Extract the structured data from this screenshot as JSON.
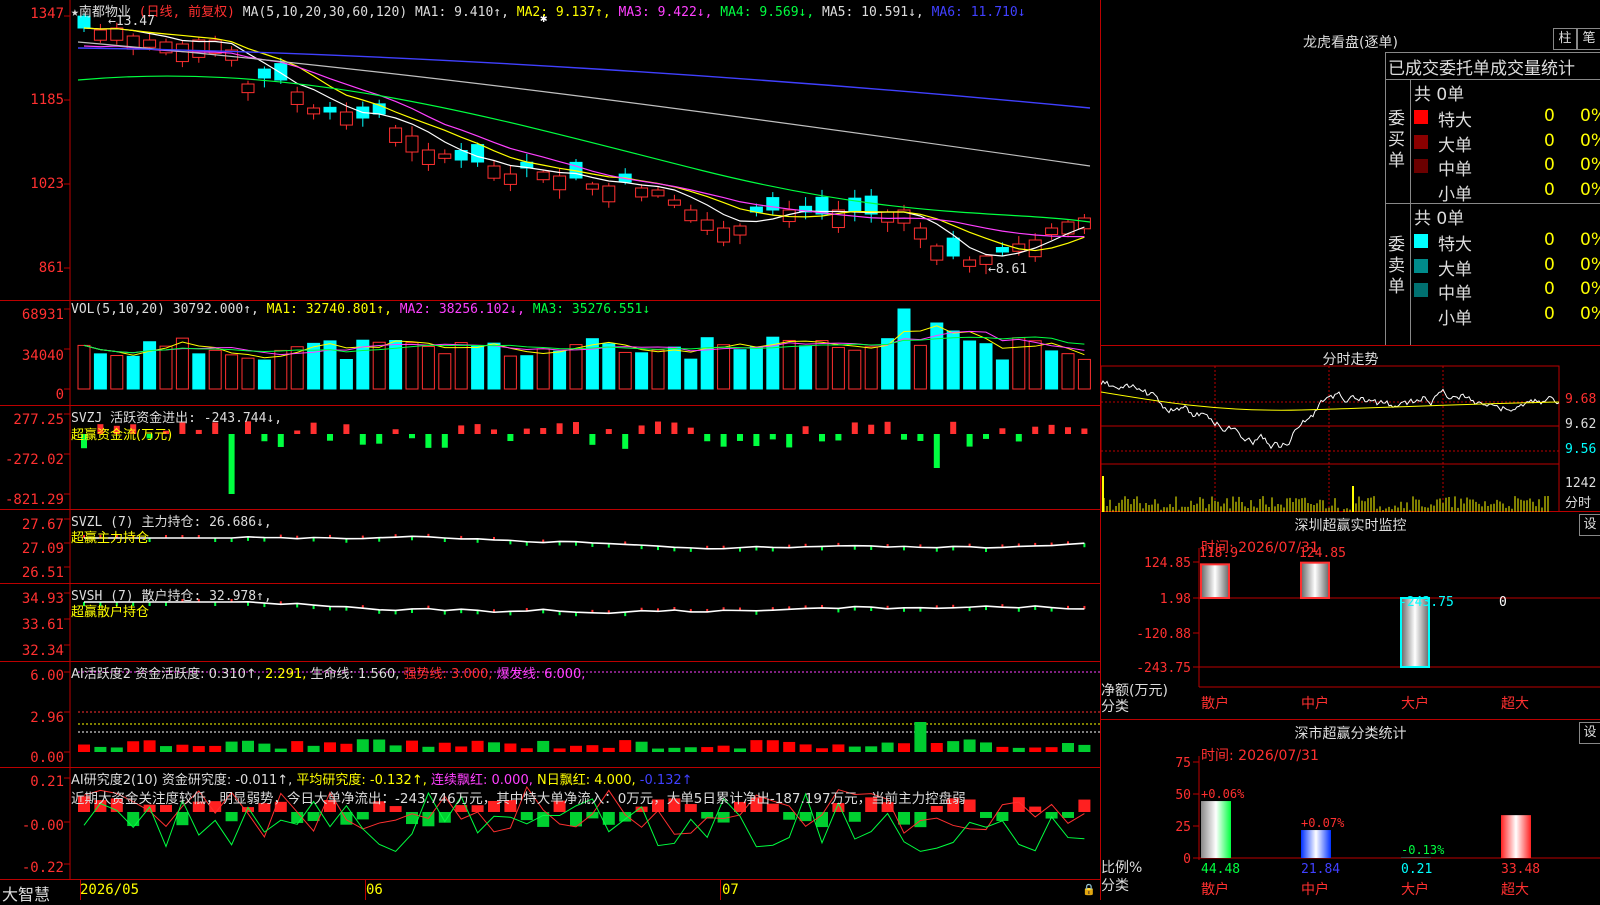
{
  "kline": {
    "stock_name": "★南都物业",
    "period": "(日线, 前复权)",
    "ma_label": "MA(5,10,20,30,60,120)",
    "ma1": "MA1: 9.410↑,",
    "ma2": "MA2: 9.137↑,",
    "ma3": "MA3: 9.422↓,",
    "ma4": "MA4: 9.569↓,",
    "ma5": "MA5: 10.591↓,",
    "ma6": "MA6: 11.710↓",
    "high_marker": "←13.47",
    "low_marker": "←8.61",
    "y_labels": [
      "1347",
      "1185",
      "1023",
      "861"
    ]
  },
  "vol": {
    "label": "VOL(5,10,20)",
    "value": "30792.000↑,",
    "ma1": "MA1: 32740.801↑,",
    "ma2": "MA2: 38256.102↓,",
    "ma3": "MA3: 35276.551↓",
    "y_labels": [
      "68931",
      "34040",
      "0"
    ]
  },
  "svzj": {
    "label": "SVZJ  活跃资金进出: -243.744↓,",
    "sub": "超赢资金流(万元)",
    "y_labels": [
      "277.25",
      "-272.02",
      "-821.29"
    ]
  },
  "svzl": {
    "label": "SVZL (7) 主力持仓: 26.686↓,",
    "sub": "超赢主力持仓",
    "y_labels": [
      "27.67",
      "27.09",
      "26.51"
    ]
  },
  "svsh": {
    "label": "SVSH (7) 散户持仓: 32.978↑,",
    "sub": "超赢散户持仓",
    "y_labels": [
      "34.93",
      "33.61",
      "32.34"
    ]
  },
  "ai_active": {
    "label": "AI活跃度2 资金活跃度: 0.310↑,",
    "v2": "2.291,",
    "life": "生命线: 1.560,",
    "strong": "强势线: 3.000,",
    "burst": "爆发线: 6.000,",
    "y_labels": [
      "6.00",
      "2.96",
      "0.00"
    ]
  },
  "ai_research": {
    "label": "AI研究度2(10) 资金研究度: -0.011↑,",
    "avg": "平均研究度: -0.132↑,",
    "red": "连续飘红: 0.000,",
    "nred": "N日飘红: 4.000,",
    "last": "-0.132↑",
    "comment": "近期大资金关注度较低，明显弱势，今日大单净流出：-243.746万元，其中特大单净流入：0万元，大单5日累计净出-187.197万元，当前主力控盘弱",
    "y_labels": [
      "0.21",
      "-0.00",
      "-0.22"
    ]
  },
  "bottom": {
    "brand": "大智慧",
    "dates": [
      "2026/05",
      "06",
      "07"
    ]
  },
  "dragon": {
    "title": "龙虎看盘(逐单)",
    "btn1": "柱",
    "btn2": "笔",
    "subtitle": "已成交委托单成交量统计",
    "buy_label": "委买单",
    "sell_label": "委卖单",
    "buy_total": "共 0单",
    "sell_total": "共 0单",
    "rows": [
      {
        "name": "特大",
        "count": "0",
        "pct": "0%",
        "color": "#ff0000"
      },
      {
        "name": "大单",
        "count": "0",
        "pct": "0%",
        "color": "#8b0000"
      },
      {
        "name": "中单",
        "count": "0",
        "pct": "0%",
        "color": "#6b0000"
      },
      {
        "name": "小单",
        "count": "0",
        "pct": "0%",
        "color": "#000000"
      }
    ],
    "rows_sell": [
      {
        "name": "特大",
        "count": "0",
        "pct": "0%",
        "color": "#00ffff"
      },
      {
        "name": "大单",
        "count": "0",
        "pct": "0%",
        "color": "#008b8b"
      },
      {
        "name": "中单",
        "count": "0",
        "pct": "0%",
        "color": "#007070"
      },
      {
        "name": "小单",
        "count": "0",
        "pct": "0%",
        "color": "#000000"
      }
    ]
  },
  "intraday": {
    "title": "分时走势",
    "prices": [
      "9.68",
      "9.62",
      "9.56"
    ],
    "vol": "1242",
    "vol_label": "分时"
  },
  "monitor": {
    "title": "深圳超赢实时监控",
    "btn": "设",
    "time": "时间: 2026/07/31",
    "y_labels": [
      "124.85",
      "1.98",
      "-120.88",
      "-243.75"
    ],
    "net_label": "净额(万元)",
    "cat_label": "分类",
    "bar_values": [
      "118.9",
      "124.85",
      "-243.75",
      "0"
    ],
    "categories": [
      "散户",
      "中户",
      "大户",
      "超大"
    ]
  },
  "classify": {
    "title": "深市超赢分类统计",
    "btn": "设",
    "time": "时间: 2026/07/31",
    "y_labels": [
      "75",
      "50",
      "25",
      "0"
    ],
    "ratio_label": "比例%",
    "cat_label": "分类",
    "top_values": [
      "+0.06%",
      "+0.07%",
      "-0.13%",
      ""
    ],
    "values": [
      "44.48",
      "21.84",
      "0.21",
      "33.48"
    ],
    "categories": [
      "散户",
      "中户",
      "大户",
      "超大"
    ]
  }
}
